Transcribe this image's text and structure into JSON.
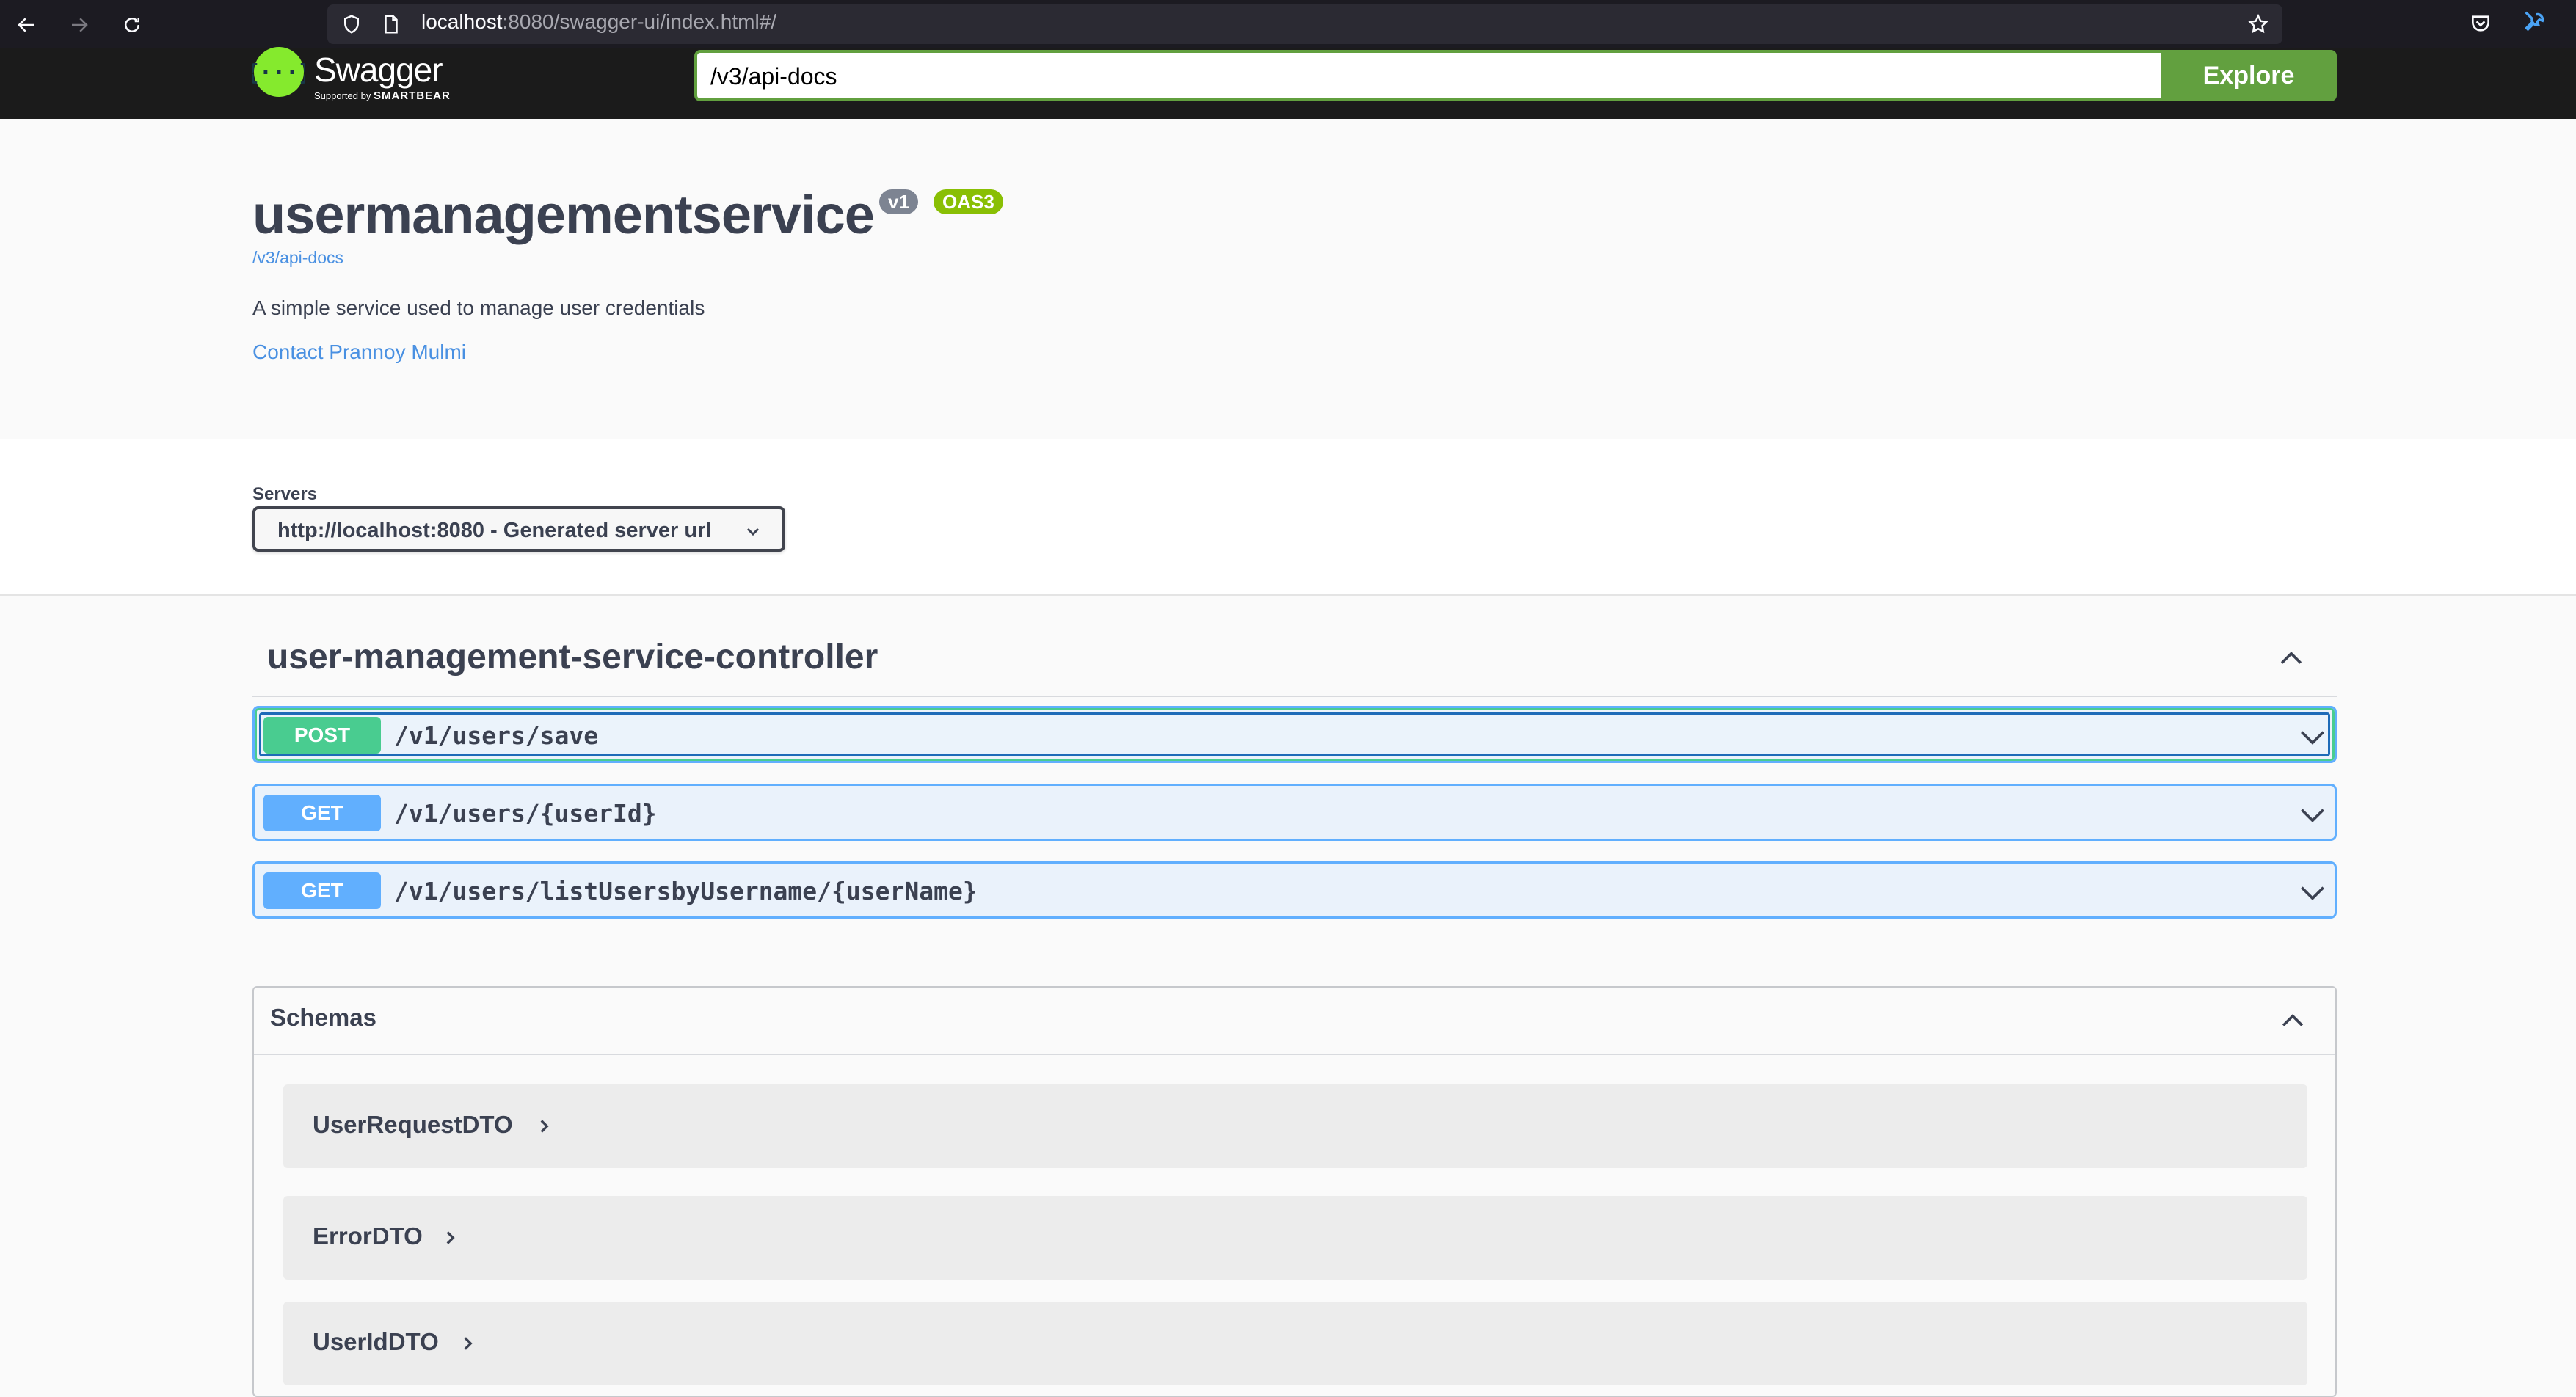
{
  "browser": {
    "url_host": "localhost",
    "url_rest": ":8080/swagger-ui/index.html#/"
  },
  "topbar": {
    "logo_text": "Swagger",
    "logo_sub_prefix": "Supported by ",
    "logo_sub_brand": "SMARTBEAR",
    "api_url_value": "/v3/api-docs",
    "explore_label": "Explore"
  },
  "info": {
    "title": "usermanagementservice",
    "version_badge": "v1",
    "spec_badge": "OAS3",
    "docs_link": "/v3/api-docs",
    "description": "A simple service used to manage user credentials",
    "contact": "Contact Prannoy Mulmi"
  },
  "servers": {
    "label": "Servers",
    "selected": "http://localhost:8080 - Generated server url"
  },
  "tag": {
    "title": "user-management-service-controller",
    "operations": [
      {
        "method": "POST",
        "path": "/v1/users/save"
      },
      {
        "method": "GET",
        "path": "/v1/users/{userId}"
      },
      {
        "method": "GET",
        "path": "/v1/users/listUsersbyUsername/{userName}"
      }
    ]
  },
  "schemas": {
    "title": "Schemas",
    "models": [
      "UserRequestDTO",
      "ErrorDTO",
      "UserIdDTO"
    ]
  },
  "colors": {
    "post": "#49cc90",
    "get": "#61affe",
    "accent": "#62a03f",
    "link": "#4990e2"
  }
}
